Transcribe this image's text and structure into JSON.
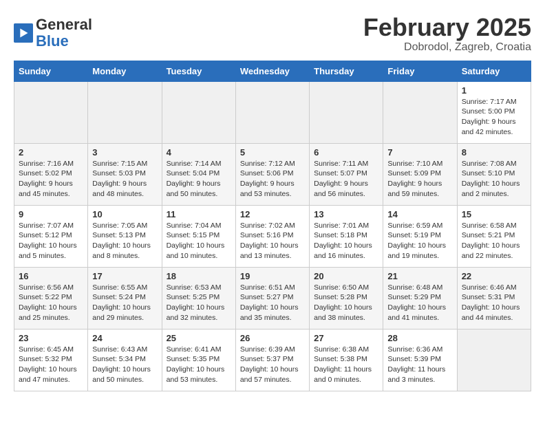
{
  "logo": {
    "general": "General",
    "blue": "Blue"
  },
  "header": {
    "title": "February 2025",
    "subtitle": "Dobrodol, Zagreb, Croatia"
  },
  "days_of_week": [
    "Sunday",
    "Monday",
    "Tuesday",
    "Wednesday",
    "Thursday",
    "Friday",
    "Saturday"
  ],
  "weeks": [
    [
      {
        "day": "",
        "info": ""
      },
      {
        "day": "",
        "info": ""
      },
      {
        "day": "",
        "info": ""
      },
      {
        "day": "",
        "info": ""
      },
      {
        "day": "",
        "info": ""
      },
      {
        "day": "",
        "info": ""
      },
      {
        "day": "1",
        "info": "Sunrise: 7:17 AM\nSunset: 5:00 PM\nDaylight: 9 hours and 42 minutes."
      }
    ],
    [
      {
        "day": "2",
        "info": "Sunrise: 7:16 AM\nSunset: 5:02 PM\nDaylight: 9 hours and 45 minutes."
      },
      {
        "day": "3",
        "info": "Sunrise: 7:15 AM\nSunset: 5:03 PM\nDaylight: 9 hours and 48 minutes."
      },
      {
        "day": "4",
        "info": "Sunrise: 7:14 AM\nSunset: 5:04 PM\nDaylight: 9 hours and 50 minutes."
      },
      {
        "day": "5",
        "info": "Sunrise: 7:12 AM\nSunset: 5:06 PM\nDaylight: 9 hours and 53 minutes."
      },
      {
        "day": "6",
        "info": "Sunrise: 7:11 AM\nSunset: 5:07 PM\nDaylight: 9 hours and 56 minutes."
      },
      {
        "day": "7",
        "info": "Sunrise: 7:10 AM\nSunset: 5:09 PM\nDaylight: 9 hours and 59 minutes."
      },
      {
        "day": "8",
        "info": "Sunrise: 7:08 AM\nSunset: 5:10 PM\nDaylight: 10 hours and 2 minutes."
      }
    ],
    [
      {
        "day": "9",
        "info": "Sunrise: 7:07 AM\nSunset: 5:12 PM\nDaylight: 10 hours and 5 minutes."
      },
      {
        "day": "10",
        "info": "Sunrise: 7:05 AM\nSunset: 5:13 PM\nDaylight: 10 hours and 8 minutes."
      },
      {
        "day": "11",
        "info": "Sunrise: 7:04 AM\nSunset: 5:15 PM\nDaylight: 10 hours and 10 minutes."
      },
      {
        "day": "12",
        "info": "Sunrise: 7:02 AM\nSunset: 5:16 PM\nDaylight: 10 hours and 13 minutes."
      },
      {
        "day": "13",
        "info": "Sunrise: 7:01 AM\nSunset: 5:18 PM\nDaylight: 10 hours and 16 minutes."
      },
      {
        "day": "14",
        "info": "Sunrise: 6:59 AM\nSunset: 5:19 PM\nDaylight: 10 hours and 19 minutes."
      },
      {
        "day": "15",
        "info": "Sunrise: 6:58 AM\nSunset: 5:21 PM\nDaylight: 10 hours and 22 minutes."
      }
    ],
    [
      {
        "day": "16",
        "info": "Sunrise: 6:56 AM\nSunset: 5:22 PM\nDaylight: 10 hours and 25 minutes."
      },
      {
        "day": "17",
        "info": "Sunrise: 6:55 AM\nSunset: 5:24 PM\nDaylight: 10 hours and 29 minutes."
      },
      {
        "day": "18",
        "info": "Sunrise: 6:53 AM\nSunset: 5:25 PM\nDaylight: 10 hours and 32 minutes."
      },
      {
        "day": "19",
        "info": "Sunrise: 6:51 AM\nSunset: 5:27 PM\nDaylight: 10 hours and 35 minutes."
      },
      {
        "day": "20",
        "info": "Sunrise: 6:50 AM\nSunset: 5:28 PM\nDaylight: 10 hours and 38 minutes."
      },
      {
        "day": "21",
        "info": "Sunrise: 6:48 AM\nSunset: 5:29 PM\nDaylight: 10 hours and 41 minutes."
      },
      {
        "day": "22",
        "info": "Sunrise: 6:46 AM\nSunset: 5:31 PM\nDaylight: 10 hours and 44 minutes."
      }
    ],
    [
      {
        "day": "23",
        "info": "Sunrise: 6:45 AM\nSunset: 5:32 PM\nDaylight: 10 hours and 47 minutes."
      },
      {
        "day": "24",
        "info": "Sunrise: 6:43 AM\nSunset: 5:34 PM\nDaylight: 10 hours and 50 minutes."
      },
      {
        "day": "25",
        "info": "Sunrise: 6:41 AM\nSunset: 5:35 PM\nDaylight: 10 hours and 53 minutes."
      },
      {
        "day": "26",
        "info": "Sunrise: 6:39 AM\nSunset: 5:37 PM\nDaylight: 10 hours and 57 minutes."
      },
      {
        "day": "27",
        "info": "Sunrise: 6:38 AM\nSunset: 5:38 PM\nDaylight: 11 hours and 0 minutes."
      },
      {
        "day": "28",
        "info": "Sunrise: 6:36 AM\nSunset: 5:39 PM\nDaylight: 11 hours and 3 minutes."
      },
      {
        "day": "",
        "info": ""
      }
    ]
  ]
}
